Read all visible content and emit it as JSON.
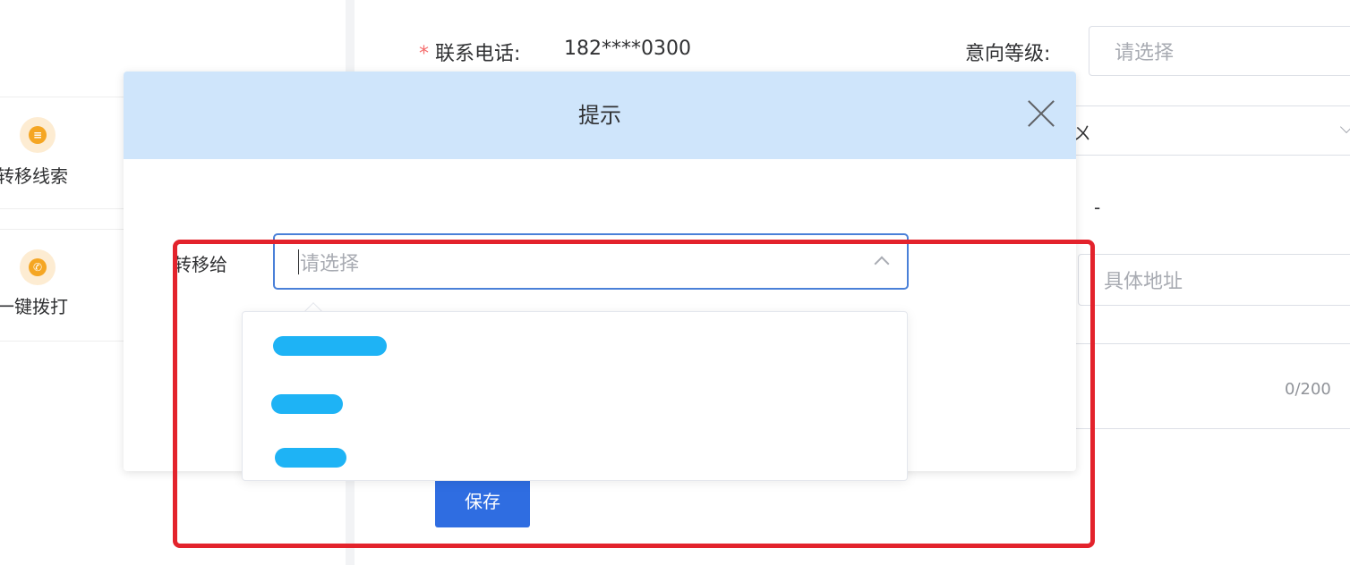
{
  "sidebar": {
    "actions": [
      {
        "label": "转移线索",
        "icon": "transfer-icon"
      },
      {
        "label": "一键拨打",
        "icon": "phone-icon"
      }
    ]
  },
  "form": {
    "phone_label": "联系电话:",
    "phone_required_mark": "*",
    "phone_value": "182****0300",
    "intent_label": "意向等级:",
    "intent_placeholder": "请选择",
    "partial_text": "ㄨ",
    "dash_text": "-",
    "address_placeholder": "具体地址",
    "remark_counter": "0/200",
    "save_label": "保存"
  },
  "dialog": {
    "title": "提示",
    "transfer_label": "转移给",
    "select_placeholder": "请选择",
    "options_note": "Three option names in the dropdown are redacted by blue scribbles."
  },
  "colors": {
    "accent": "#2f6de1",
    "dialog_header": "#cfe5fb",
    "highlight": "#e3232c",
    "redaction": "#1eb3f5",
    "required": "#f56c6c"
  }
}
